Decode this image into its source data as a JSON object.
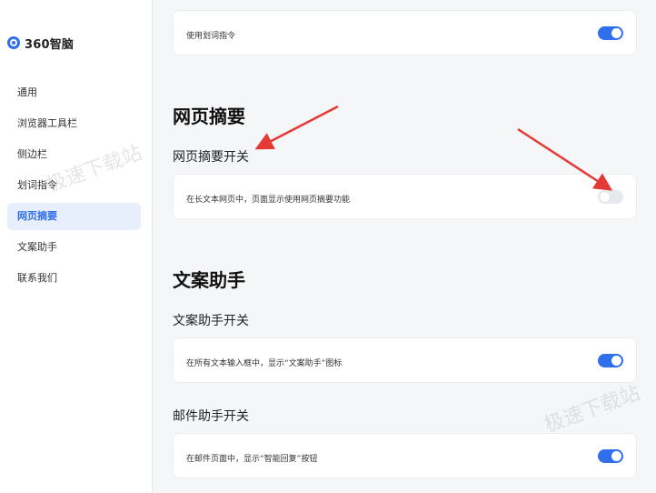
{
  "app": {
    "logo_text": "360智脑"
  },
  "sidebar": {
    "items": [
      {
        "label": "通用",
        "active": false
      },
      {
        "label": "浏览器工具栏",
        "active": false
      },
      {
        "label": "侧边栏",
        "active": false
      },
      {
        "label": "划词指令",
        "active": false
      },
      {
        "label": "网页摘要",
        "active": true
      },
      {
        "label": "文案助手",
        "active": false
      },
      {
        "label": "联系我们",
        "active": false
      }
    ]
  },
  "main": {
    "top_card": {
      "text": "使用划词指令",
      "toggle_on": true
    },
    "sections": [
      {
        "title": "网页摘要",
        "subtitle": "网页摘要开关",
        "card": {
          "text": "在长文本网页中，页面显示使用网页摘要功能",
          "toggle_on": false
        }
      },
      {
        "title": "文案助手",
        "subtitle": "文案助手开关",
        "card": {
          "text": "在所有文本输入框中，显示“文案助手”图标",
          "toggle_on": true
        }
      }
    ],
    "mail_subtitle": "邮件助手开关",
    "mail_card": {
      "text": "在邮件页面中，显示“智能回复”按钮",
      "toggle_on": true
    }
  },
  "watermarks": [
    "极速下载站",
    "极速下载站"
  ],
  "colors": {
    "accent": "#2f6fec",
    "arrow": "#e53935",
    "sidebar_active_bg": "#e7effd"
  }
}
